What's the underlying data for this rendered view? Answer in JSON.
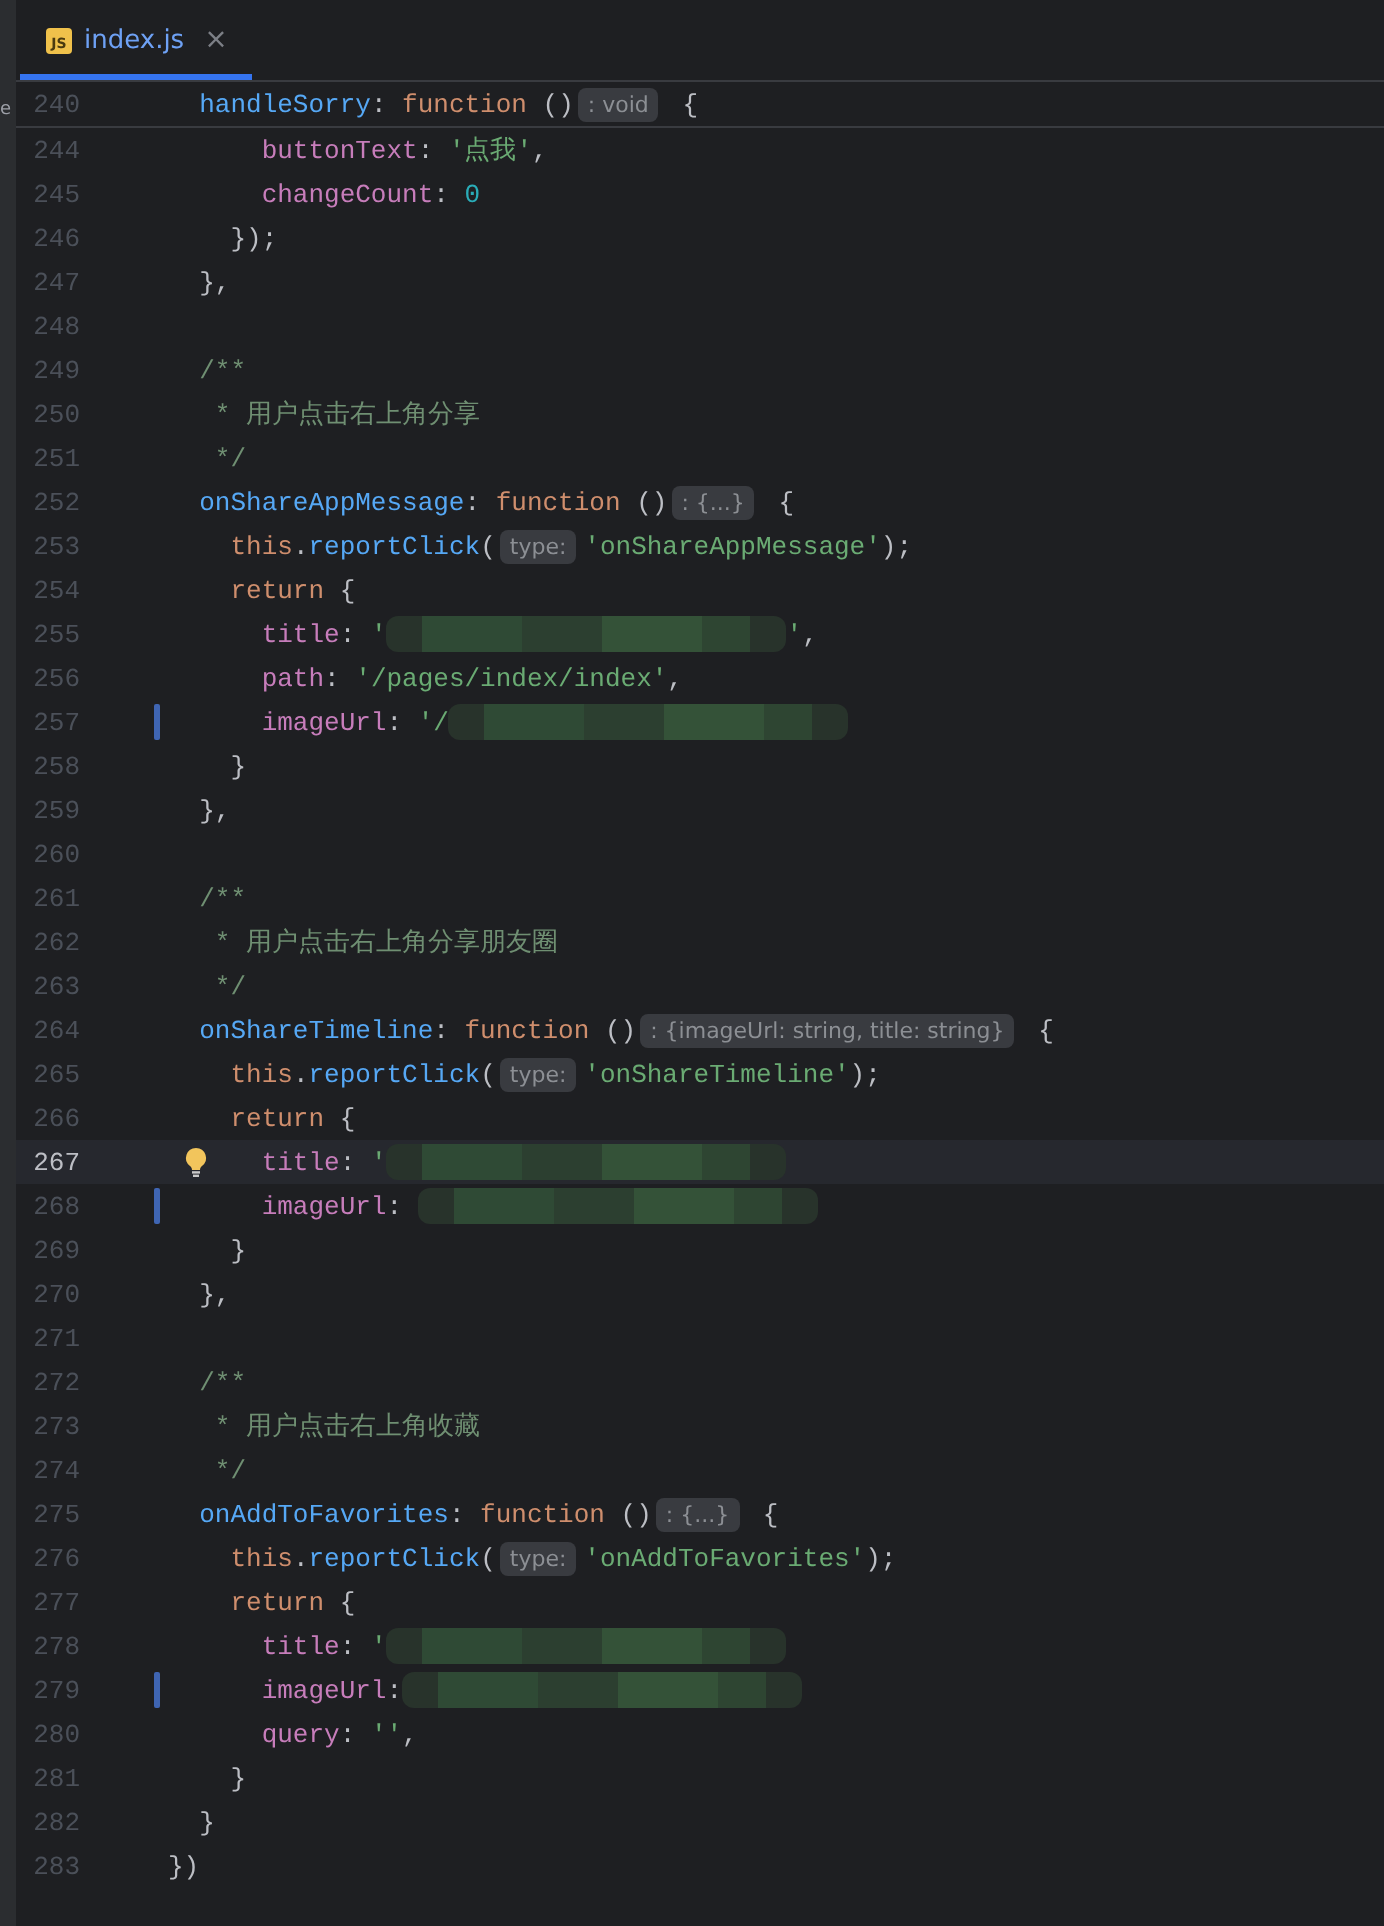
{
  "sidebar_fragment": "e",
  "tabs": [
    {
      "icon_text": "JS",
      "label": "index.js",
      "close": "×",
      "selected": true
    }
  ],
  "sticky_line": {
    "number": "240",
    "tokens": [
      {
        "kind": "fn",
        "text": "  handleSorry"
      },
      {
        "kind": "punc",
        "text": ": "
      },
      {
        "kind": "kw",
        "text": "function"
      },
      {
        "kind": "punc",
        "text": " ()"
      },
      {
        "kind": "hint",
        "text": ": void"
      },
      {
        "kind": "punc",
        "text": " {"
      }
    ]
  },
  "lines": [
    {
      "number": "244",
      "tokens": [
        {
          "kind": "key",
          "text": "      buttonText"
        },
        {
          "kind": "punc",
          "text": ": "
        },
        {
          "kind": "str",
          "text": "'点我'"
        },
        {
          "kind": "punc",
          "text": ","
        }
      ]
    },
    {
      "number": "245",
      "tokens": [
        {
          "kind": "key",
          "text": "      changeCount"
        },
        {
          "kind": "punc",
          "text": ": "
        },
        {
          "kind": "num",
          "text": "0"
        }
      ]
    },
    {
      "number": "246",
      "tokens": [
        {
          "kind": "punc",
          "text": "    });"
        }
      ]
    },
    {
      "number": "247",
      "tokens": [
        {
          "kind": "punc",
          "text": "  },"
        }
      ]
    },
    {
      "number": "248"
    },
    {
      "number": "249",
      "tokens": [
        {
          "kind": "comment",
          "text": "  /**"
        }
      ]
    },
    {
      "number": "250",
      "tokens": [
        {
          "kind": "comment",
          "text": "   * 用户点击右上角分享"
        }
      ]
    },
    {
      "number": "251",
      "tokens": [
        {
          "kind": "comment",
          "text": "   */"
        }
      ]
    },
    {
      "number": "252",
      "tokens": [
        {
          "kind": "fn",
          "text": "  onShareAppMessage"
        },
        {
          "kind": "punc",
          "text": ": "
        },
        {
          "kind": "kw",
          "text": "function"
        },
        {
          "kind": "punc",
          "text": " ()"
        },
        {
          "kind": "hint",
          "text": ": {...}"
        },
        {
          "kind": "punc",
          "text": " {"
        }
      ]
    },
    {
      "number": "253",
      "tokens": [
        {
          "kind": "kw",
          "text": "    this"
        },
        {
          "kind": "punc",
          "text": "."
        },
        {
          "kind": "fn",
          "text": "reportClick"
        },
        {
          "kind": "punc",
          "text": "("
        },
        {
          "kind": "hint",
          "text": "type:"
        },
        {
          "kind": "str",
          "text": "'onShareAppMessage'"
        },
        {
          "kind": "punc",
          "text": ");"
        }
      ]
    },
    {
      "number": "254",
      "tokens": [
        {
          "kind": "kw",
          "text": "    return"
        },
        {
          "kind": "punc",
          "text": " {"
        }
      ]
    },
    {
      "number": "255",
      "tokens": [
        {
          "kind": "key",
          "text": "      title"
        },
        {
          "kind": "punc",
          "text": ": "
        },
        {
          "kind": "str",
          "text": "'"
        },
        {
          "kind": "blur"
        },
        {
          "kind": "str",
          "text": "'"
        },
        {
          "kind": "punc",
          "text": ","
        }
      ]
    },
    {
      "number": "256",
      "tokens": [
        {
          "kind": "key",
          "text": "      path"
        },
        {
          "kind": "punc",
          "text": ": "
        },
        {
          "kind": "str",
          "text": "'/pages/index/index'"
        },
        {
          "kind": "punc",
          "text": ","
        }
      ]
    },
    {
      "number": "257",
      "changed": true,
      "tokens": [
        {
          "kind": "key",
          "text": "      imageUrl"
        },
        {
          "kind": "punc",
          "text": ": "
        },
        {
          "kind": "str",
          "text": "'/"
        },
        {
          "kind": "blur"
        }
      ]
    },
    {
      "number": "258",
      "tokens": [
        {
          "kind": "punc",
          "text": "    }"
        }
      ]
    },
    {
      "number": "259",
      "tokens": [
        {
          "kind": "punc",
          "text": "  },"
        }
      ]
    },
    {
      "number": "260"
    },
    {
      "number": "261",
      "tokens": [
        {
          "kind": "comment",
          "text": "  /**"
        }
      ]
    },
    {
      "number": "262",
      "tokens": [
        {
          "kind": "comment",
          "text": "   * 用户点击右上角分享朋友圈"
        }
      ]
    },
    {
      "number": "263",
      "tokens": [
        {
          "kind": "comment",
          "text": "   */"
        }
      ]
    },
    {
      "number": "264",
      "tokens": [
        {
          "kind": "fn",
          "text": "  onShareTimeline"
        },
        {
          "kind": "punc",
          "text": ": "
        },
        {
          "kind": "kw",
          "text": "function"
        },
        {
          "kind": "punc",
          "text": " ()"
        },
        {
          "kind": "hint",
          "text": ": {imageUrl: string, title: string}"
        },
        {
          "kind": "punc",
          "text": " {"
        }
      ]
    },
    {
      "number": "265",
      "tokens": [
        {
          "kind": "kw",
          "text": "    this"
        },
        {
          "kind": "punc",
          "text": "."
        },
        {
          "kind": "fn",
          "text": "reportClick"
        },
        {
          "kind": "punc",
          "text": "("
        },
        {
          "kind": "hint",
          "text": "type:"
        },
        {
          "kind": "str",
          "text": "'onShareTimeline'"
        },
        {
          "kind": "punc",
          "text": ");"
        }
      ]
    },
    {
      "number": "266",
      "tokens": [
        {
          "kind": "kw",
          "text": "    return"
        },
        {
          "kind": "punc",
          "text": " {"
        }
      ]
    },
    {
      "number": "267",
      "current": true,
      "bulb": true,
      "tokens": [
        {
          "kind": "key",
          "text": "      title"
        },
        {
          "kind": "punc",
          "text": ": "
        },
        {
          "kind": "str",
          "text": "'"
        },
        {
          "kind": "blur"
        }
      ]
    },
    {
      "number": "268",
      "changed": true,
      "tokens": [
        {
          "kind": "key",
          "text": "      imageUrl"
        },
        {
          "kind": "punc",
          "text": ": "
        },
        {
          "kind": "blur"
        }
      ]
    },
    {
      "number": "269",
      "tokens": [
        {
          "kind": "punc",
          "text": "    }"
        }
      ]
    },
    {
      "number": "270",
      "tokens": [
        {
          "kind": "punc",
          "text": "  },"
        }
      ]
    },
    {
      "number": "271"
    },
    {
      "number": "272",
      "tokens": [
        {
          "kind": "comment",
          "text": "  /**"
        }
      ]
    },
    {
      "number": "273",
      "tokens": [
        {
          "kind": "comment",
          "text": "   * 用户点击右上角收藏"
        }
      ]
    },
    {
      "number": "274",
      "tokens": [
        {
          "kind": "comment",
          "text": "   */"
        }
      ]
    },
    {
      "number": "275",
      "tokens": [
        {
          "kind": "fn",
          "text": "  onAddToFavorites"
        },
        {
          "kind": "punc",
          "text": ": "
        },
        {
          "kind": "kw",
          "text": "function"
        },
        {
          "kind": "punc",
          "text": " ()"
        },
        {
          "kind": "hint",
          "text": ": {...}"
        },
        {
          "kind": "punc",
          "text": " {"
        }
      ]
    },
    {
      "number": "276",
      "tokens": [
        {
          "kind": "kw",
          "text": "    this"
        },
        {
          "kind": "punc",
          "text": "."
        },
        {
          "kind": "fn",
          "text": "reportClick"
        },
        {
          "kind": "punc",
          "text": "("
        },
        {
          "kind": "hint",
          "text": "type:"
        },
        {
          "kind": "str",
          "text": "'onAddToFavorites'"
        },
        {
          "kind": "punc",
          "text": ");"
        }
      ]
    },
    {
      "number": "277",
      "tokens": [
        {
          "kind": "kw",
          "text": "    return"
        },
        {
          "kind": "punc",
          "text": " {"
        }
      ]
    },
    {
      "number": "278",
      "tokens": [
        {
          "kind": "key",
          "text": "      title"
        },
        {
          "kind": "punc",
          "text": ": "
        },
        {
          "kind": "str",
          "text": "'"
        },
        {
          "kind": "blur"
        }
      ]
    },
    {
      "number": "279",
      "changed": true,
      "tokens": [
        {
          "kind": "key",
          "text": "      imageUrl"
        },
        {
          "kind": "punc",
          "text": ":"
        },
        {
          "kind": "blur"
        }
      ]
    },
    {
      "number": "280",
      "tokens": [
        {
          "kind": "key",
          "text": "      query"
        },
        {
          "kind": "punc",
          "text": ": "
        },
        {
          "kind": "str",
          "text": "''"
        },
        {
          "kind": "punc",
          "text": ","
        }
      ]
    },
    {
      "number": "281",
      "tokens": [
        {
          "kind": "punc",
          "text": "    }"
        }
      ]
    },
    {
      "number": "282",
      "tokens": [
        {
          "kind": "punc",
          "text": "  }"
        }
      ]
    },
    {
      "number": "283",
      "tokens": [
        {
          "kind": "punc",
          "text": "})"
        }
      ]
    }
  ]
}
